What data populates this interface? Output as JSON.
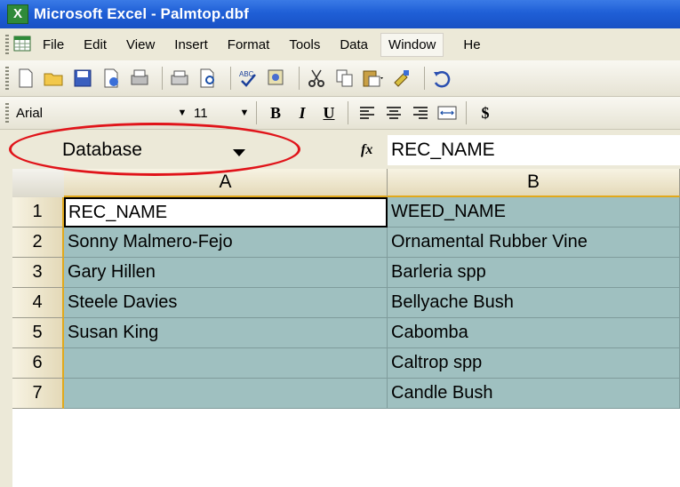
{
  "window": {
    "title": "Microsoft Excel - Palmtop.dbf",
    "app_icon": "excel-icon"
  },
  "menubar": {
    "items": [
      {
        "label": "File"
      },
      {
        "label": "Edit"
      },
      {
        "label": "View"
      },
      {
        "label": "Insert"
      },
      {
        "label": "Format"
      },
      {
        "label": "Tools"
      },
      {
        "label": "Data"
      },
      {
        "label": "Window"
      },
      {
        "label": "He"
      }
    ]
  },
  "toolbar": {
    "buttons": [
      "new-icon",
      "open-icon",
      "save-icon",
      "permission-icon",
      "print-preview-icon",
      "print-icon",
      "preview-icon",
      "spelling-icon",
      "research-icon",
      "cut-icon",
      "copy-icon",
      "paste-icon",
      "format-painter-icon",
      "undo-icon"
    ]
  },
  "formatting": {
    "font": "Arial",
    "size": "11",
    "bold": "B",
    "italic": "I",
    "underline": "U",
    "currency": "$"
  },
  "formula_bar": {
    "name_box": "Database",
    "fx": "fx",
    "formula": "REC_NAME"
  },
  "grid": {
    "columns": [
      "A",
      "B"
    ],
    "rows": [
      {
        "num": "1",
        "a": "REC_NAME",
        "b": "WEED_NAME"
      },
      {
        "num": "2",
        "a": "Sonny Malmero-Fejo",
        "b": "Ornamental Rubber Vine"
      },
      {
        "num": "3",
        "a": "Gary Hillen",
        "b": "Barleria spp"
      },
      {
        "num": "4",
        "a": "Steele Davies",
        "b": "Bellyache Bush"
      },
      {
        "num": "5",
        "a": "Susan King",
        "b": "Cabomba"
      },
      {
        "num": "6",
        "a": "",
        "b": "Caltrop spp"
      },
      {
        "num": "7",
        "a": "",
        "b": "Candle Bush"
      }
    ]
  },
  "colors": {
    "selection_fill": "#9fc0c0",
    "annotation": "#e0141a",
    "header_highlight": "#e1a91c"
  }
}
